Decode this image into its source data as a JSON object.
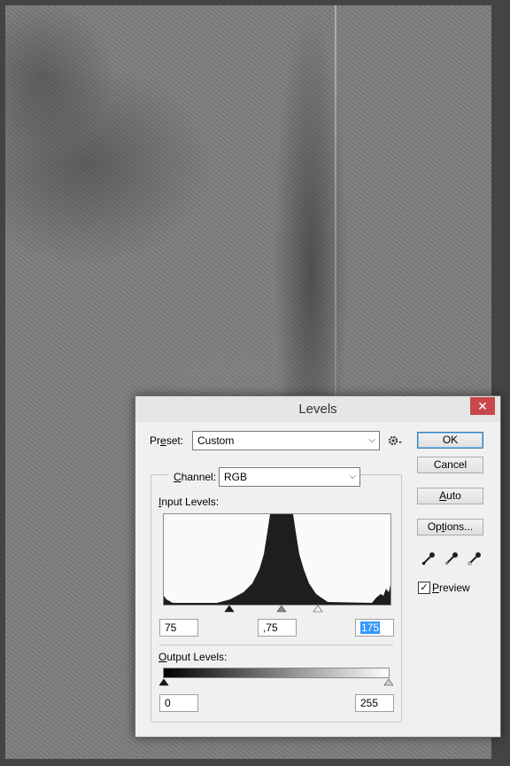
{
  "dialog": {
    "title": "Levels",
    "close_glyph": "✕",
    "preset": {
      "prefix": "Pr",
      "accel": "e",
      "suffix": "set:",
      "value": "Custom"
    },
    "channel": {
      "accel": "C",
      "suffix": "hannel:",
      "value": "RGB"
    },
    "input_levels": {
      "accel": "I",
      "suffix": "nput Levels:",
      "black": "75",
      "gamma": ",75",
      "white": "175"
    },
    "output_levels": {
      "accel": "O",
      "suffix": "utput Levels:",
      "black": "0",
      "white": "255"
    },
    "buttons": {
      "ok": "OK",
      "cancel": "Cancel",
      "auto_accel": "A",
      "auto_suffix": "uto",
      "options_prefix": "Op",
      "options_accel": "t",
      "options_suffix": "ions..."
    },
    "preview": {
      "accel": "P",
      "suffix": "review",
      "checked": true
    },
    "icons": [
      "gear-icon",
      "black-eyedropper-icon",
      "gray-eyedropper-icon",
      "white-eyedropper-icon"
    ]
  },
  "colors": {
    "close_button": "#c7474a",
    "selection": "#3399ff",
    "default_button_border": "#3c7fb1"
  }
}
